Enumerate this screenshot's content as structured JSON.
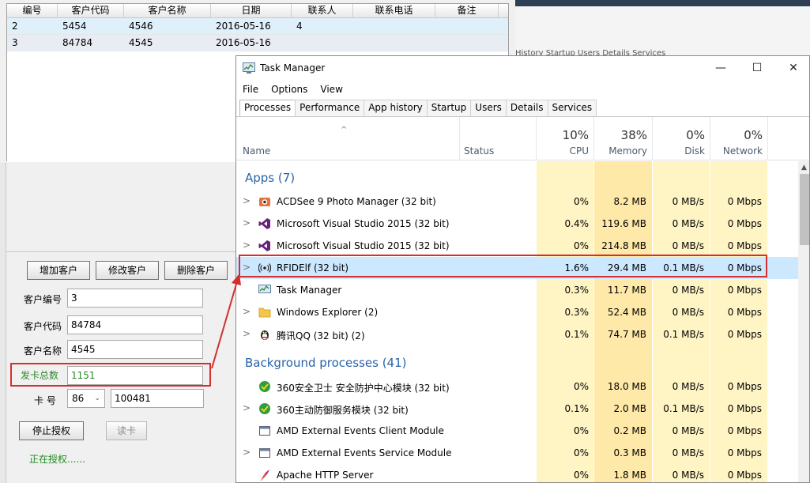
{
  "left_app": {
    "columns": [
      "编号",
      "客户代码",
      "客户名称",
      "日期",
      "联系人",
      "联系电话",
      "备注"
    ],
    "rows": [
      [
        "2",
        "5454",
        "4546",
        "2016-05-16",
        "4",
        "",
        ""
      ],
      [
        "3",
        "84784",
        "4545",
        "2016-05-16",
        "",
        "",
        ""
      ]
    ],
    "buttons": {
      "add": "增加客户",
      "edit": "修改客户",
      "delete": "删除客户",
      "stop": "停止授权",
      "read": "读卡"
    },
    "form": {
      "number_label": "客户编号",
      "number_value": "3",
      "code_label": "客户代码",
      "code_value": "84784",
      "name_label": "客户名称",
      "name_value": "4545",
      "count_label": "发卡总数",
      "count_value": "1151",
      "card_label": "卡 号",
      "card_prefix": "86",
      "card_value": "100481"
    },
    "status": "正在授权......"
  },
  "bg_window": {
    "tabs": "History Startup Users Details Services"
  },
  "task_manager": {
    "title": "Task Manager",
    "menu": [
      "File",
      "Options",
      "View"
    ],
    "tabs": [
      "Processes",
      "Performance",
      "App history",
      "Startup",
      "Users",
      "Details",
      "Services"
    ],
    "header": {
      "name": "Name",
      "status": "Status",
      "cpu_pct": "10%",
      "cpu": "CPU",
      "mem_pct": "38%",
      "mem": "Memory",
      "disk_pct": "0%",
      "disk": "Disk",
      "net_pct": "0%",
      "net": "Network"
    },
    "apps_group": "Apps (7)",
    "bg_group": "Background processes (41)",
    "apps": [
      {
        "name": "ACDSee 9 Photo Manager (32 bit)",
        "cpu": "0%",
        "mem": "8.2 MB",
        "disk": "0 MB/s",
        "net": "0 Mbps",
        "icon": "camera-icon"
      },
      {
        "name": "Microsoft Visual Studio 2015 (32 bit)",
        "cpu": "0.4%",
        "mem": "119.6 MB",
        "disk": "0 MB/s",
        "net": "0 Mbps",
        "icon": "visual-studio-icon"
      },
      {
        "name": "Microsoft Visual Studio 2015 (32 bit)",
        "cpu": "0%",
        "mem": "214.8 MB",
        "disk": "0 MB/s",
        "net": "0 Mbps",
        "icon": "visual-studio-icon"
      },
      {
        "name": "RFIDElf (32 bit)",
        "cpu": "1.6%",
        "mem": "29.4 MB",
        "disk": "0.1 MB/s",
        "net": "0 Mbps",
        "icon": "rfid-icon"
      },
      {
        "name": "Task Manager",
        "cpu": "0.3%",
        "mem": "11.7 MB",
        "disk": "0 MB/s",
        "net": "0 Mbps",
        "icon": "task-manager-icon"
      },
      {
        "name": "Windows Explorer (2)",
        "cpu": "0.3%",
        "mem": "52.4 MB",
        "disk": "0 MB/s",
        "net": "0 Mbps",
        "icon": "folder-icon"
      },
      {
        "name": "腾讯QQ (32 bit) (2)",
        "cpu": "0.1%",
        "mem": "74.7 MB",
        "disk": "0.1 MB/s",
        "net": "0 Mbps",
        "icon": "qq-penguin-icon"
      }
    ],
    "background": [
      {
        "name": "360安全卫士 安全防护中心模块 (32 bit)",
        "cpu": "0%",
        "mem": "18.0 MB",
        "disk": "0 MB/s",
        "net": "0 Mbps",
        "icon": "shield-360-icon"
      },
      {
        "name": "360主动防御服务模块 (32 bit)",
        "cpu": "0.1%",
        "mem": "2.0 MB",
        "disk": "0.1 MB/s",
        "net": "0 Mbps",
        "icon": "shield-360-icon"
      },
      {
        "name": "AMD External Events Client Module",
        "cpu": "0%",
        "mem": "0.2 MB",
        "disk": "0 MB/s",
        "net": "0 Mbps",
        "icon": "service-icon"
      },
      {
        "name": "AMD External Events Service Module",
        "cpu": "0%",
        "mem": "0.3 MB",
        "disk": "0 MB/s",
        "net": "0 Mbps",
        "icon": "service-icon"
      },
      {
        "name": "Apache HTTP Server",
        "cpu": "0%",
        "mem": "1.8 MB",
        "disk": "0 MB/s",
        "net": "0 Mbps",
        "icon": "apache-feather-icon"
      }
    ],
    "colors": {
      "heat_light": "#fff4c4",
      "heat_mid": "#ffe9a8",
      "highlight": "#cce8ff",
      "annotation": "#d32f2f"
    }
  }
}
